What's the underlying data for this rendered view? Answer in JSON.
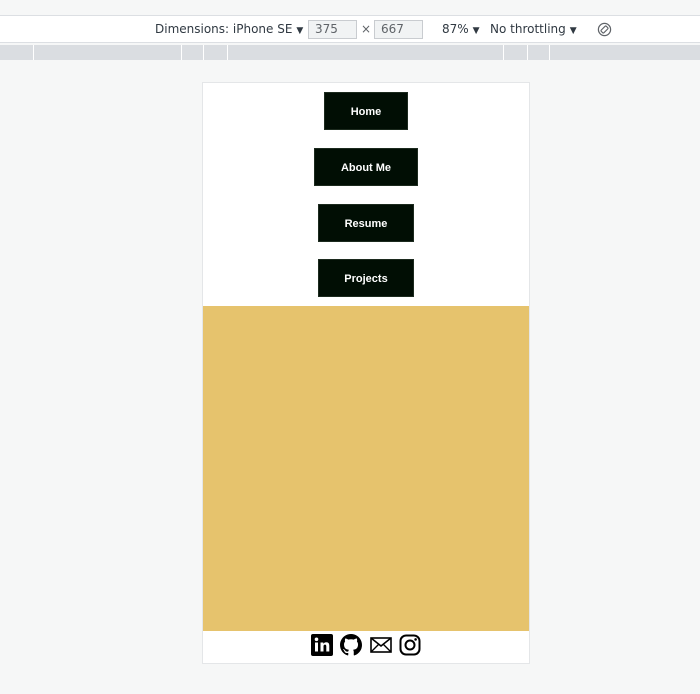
{
  "devtools": {
    "dimensions_label": "Dimensions: iPhone SE",
    "width": "375",
    "times": "×",
    "height": "667",
    "zoom": "87%",
    "throttling": "No throttling",
    "caret": "▼"
  },
  "nav": {
    "home": "Home",
    "about": "About Me",
    "resume": "Resume",
    "projects": "Projects"
  },
  "colors": {
    "nav_button_bg": "#010e04",
    "hero_bg": "#e6c36d"
  },
  "footer": {
    "icons": [
      "linkedin-icon",
      "github-icon",
      "email-icon",
      "instagram-icon"
    ]
  }
}
